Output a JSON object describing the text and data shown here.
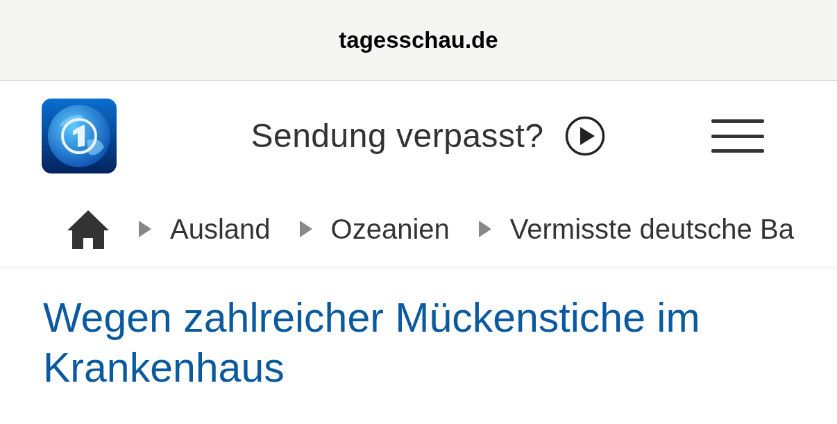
{
  "address_bar": {
    "url": "tagesschau.de"
  },
  "header": {
    "missed_show_link": "Sendung verpasst?"
  },
  "breadcrumb": [
    "Ausland",
    "Ozeanien",
    "Vermisste deutsche Ba"
  ],
  "article": {
    "headline": "Wegen zahlreicher Mückenstiche im Krankenhaus"
  }
}
